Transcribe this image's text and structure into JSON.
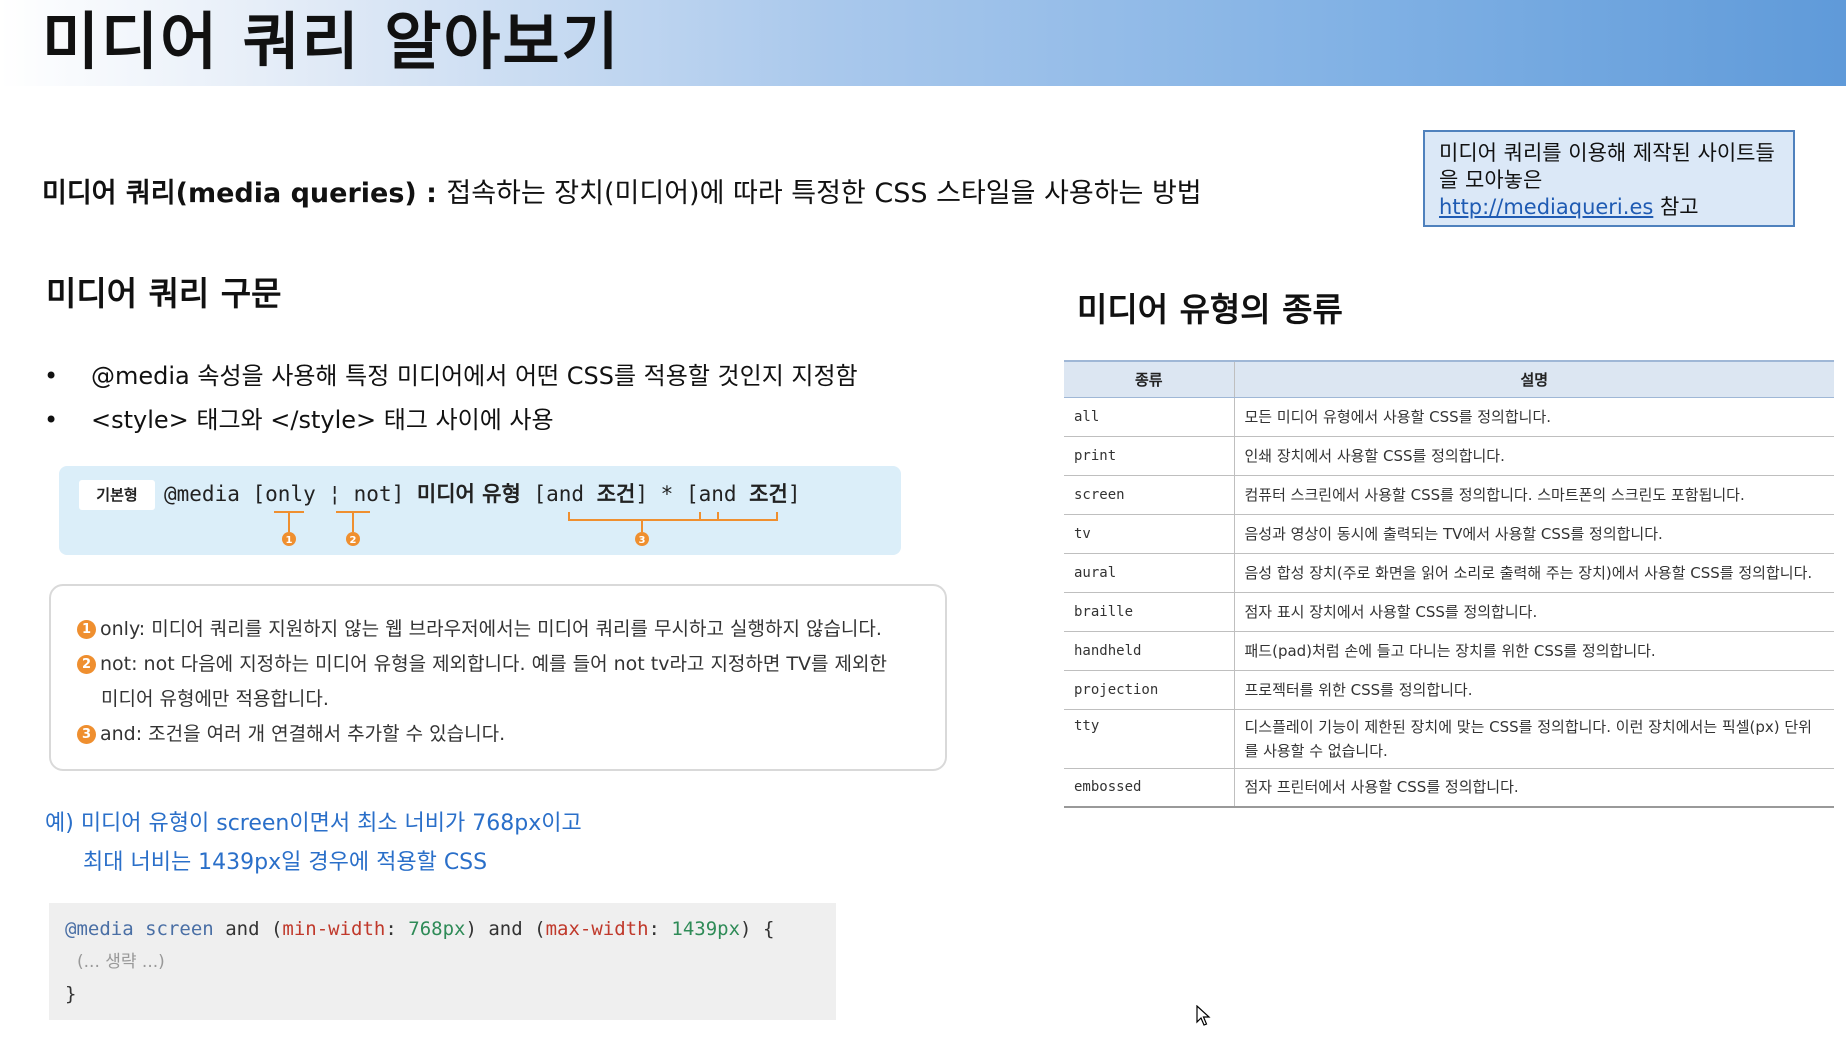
{
  "header": {
    "title": "미디어 쿼리 알아보기"
  },
  "definition": {
    "term": "미디어 쿼리(media queries)",
    "separator": " : ",
    "text": "접속하는 장치(미디어)에 따라 특정한 CSS 스타일을 사용하는 방법"
  },
  "reference": {
    "text": "미디어 쿼리를 이용해 제작된 사이트들을 모아놓은",
    "link": "http://mediaqueri.es",
    "suffix": " 참고"
  },
  "syntax_section": {
    "heading": "미디어 쿼리 구문",
    "bullets": [
      "@media 속성을 사용해 특정 미디어에서 어떤 CSS를 적용할 것인지 지정함",
      "<style> 태그와 </style> 태그 사이에 사용"
    ],
    "bullet_symbol": "•",
    "box": {
      "tag": "기본형",
      "parts": {
        "media": "@media",
        "only_not": "[only ¦ not]",
        "type": "미디어 유형",
        "and1_open": "[and ",
        "and1_cond": "조건",
        "and1_close": "]",
        "star": "*",
        "and2_open": "[and ",
        "and2_cond": "조건",
        "and2_close": "]"
      },
      "markers": [
        "1",
        "2",
        "3"
      ]
    },
    "explanations": [
      {
        "num": "1",
        "text": "only: 미디어 쿼리를 지원하지 않는 웹 브라우저에서는 미디어 쿼리를 무시하고 실행하지 않습니다."
      },
      {
        "num": "2",
        "text": "not: not 다음에 지정하는 미디어 유형을 제외합니다. 예를 들어 not tv라고 지정하면 TV를 제외한"
      },
      {
        "num": "",
        "text": "미디어 유형에만 적용합니다."
      },
      {
        "num": "3",
        "text": "and: 조건을 여러 개 연결해서 추가할 수 있습니다."
      }
    ],
    "example": {
      "line1": "예) 미디어 유형이 screen이면서 최소 너비가 768px이고",
      "line2": "최대 너비는 1439px일 경우에 적용할 CSS"
    },
    "code": {
      "at_media": "@media",
      "screen": "screen",
      "and1": "and",
      "min_prop": "min-width",
      "min_val": "768px",
      "and2": "and",
      "max_prop": "max-width",
      "max_val": "1439px",
      "open_brace": "{",
      "comment": "(... 생략 ...)",
      "close_brace": "}"
    }
  },
  "types_section": {
    "heading": "미디어 유형의 종류",
    "columns": [
      "종류",
      "설명"
    ],
    "rows": [
      [
        "all",
        "모든 미디어 유형에서 사용할 CSS를 정의합니다."
      ],
      [
        "print",
        "인쇄 장치에서 사용할 CSS를 정의합니다."
      ],
      [
        "screen",
        "컴퓨터 스크린에서 사용할 CSS를 정의합니다. 스마트폰의 스크린도 포함됩니다."
      ],
      [
        "tv",
        "음성과 영상이 동시에 출력되는 TV에서 사용할 CSS를 정의합니다."
      ],
      [
        "aural",
        "음성 합성 장치(주로 화면을 읽어 소리로 출력해 주는 장치)에서 사용할 CSS를 정의합니다."
      ],
      [
        "braille",
        "점자 표시 장치에서 사용할 CSS를 정의합니다."
      ],
      [
        "handheld",
        "패드(pad)처럼 손에 들고 다니는 장치를 위한 CSS를 정의합니다."
      ],
      [
        "projection",
        "프로젝터를 위한 CSS를 정의합니다."
      ],
      [
        "tty",
        "디스플레이 기능이 제한된 장치에 맞는 CSS를 정의합니다. 이런 장치에서는 픽셀(px) 단위를 사용할 수 없습니다."
      ],
      [
        "embossed",
        "점자 프린터에서 사용할 CSS를 정의합니다."
      ]
    ]
  },
  "icons": {
    "cursor": "mouse-pointer-icon"
  },
  "colors": {
    "accent": "#5f9ad9",
    "marker": "#ef8f2f",
    "example_text": "#2a6fc9"
  }
}
